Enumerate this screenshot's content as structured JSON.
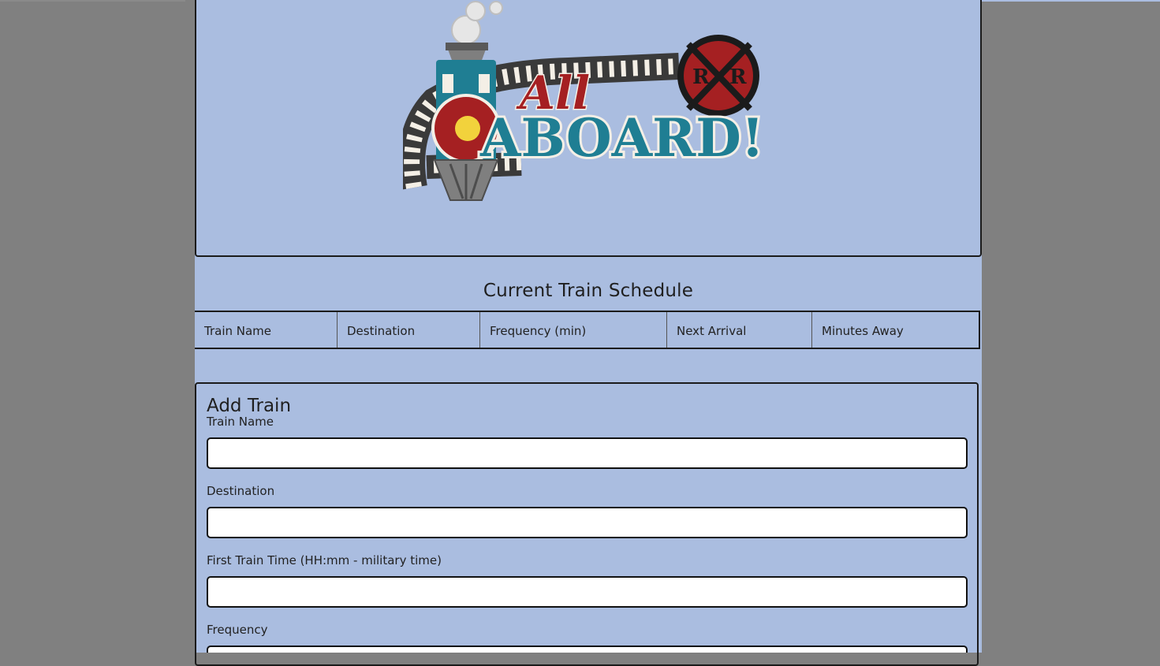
{
  "logo": {
    "text_top": "All",
    "text_main": "ABOARD!",
    "crossing_sign": "R R",
    "colors": {
      "teal": "#1f7e93",
      "red": "#a52022",
      "gray": "#7f7f7f",
      "yellow": "#f2d23c",
      "track": "#3a3a3a",
      "cream": "#f4efe6"
    }
  },
  "schedule": {
    "title": "Current Train Schedule",
    "columns": [
      "Train Name",
      "Destination",
      "Frequency (min)",
      "Next Arrival",
      "Minutes Away"
    ]
  },
  "form": {
    "title": "Add Train",
    "fields": [
      {
        "label": "Train Name",
        "value": "",
        "placeholder": ""
      },
      {
        "label": "Destination",
        "value": "",
        "placeholder": ""
      },
      {
        "label": "First Train Time (HH:mm - military time)",
        "value": "",
        "placeholder": ""
      },
      {
        "label": "Frequency",
        "value": "",
        "placeholder": ""
      }
    ]
  },
  "colors": {
    "page_background": "#aabde0",
    "outer_background": "#808080",
    "border": "#1b1b1b"
  }
}
